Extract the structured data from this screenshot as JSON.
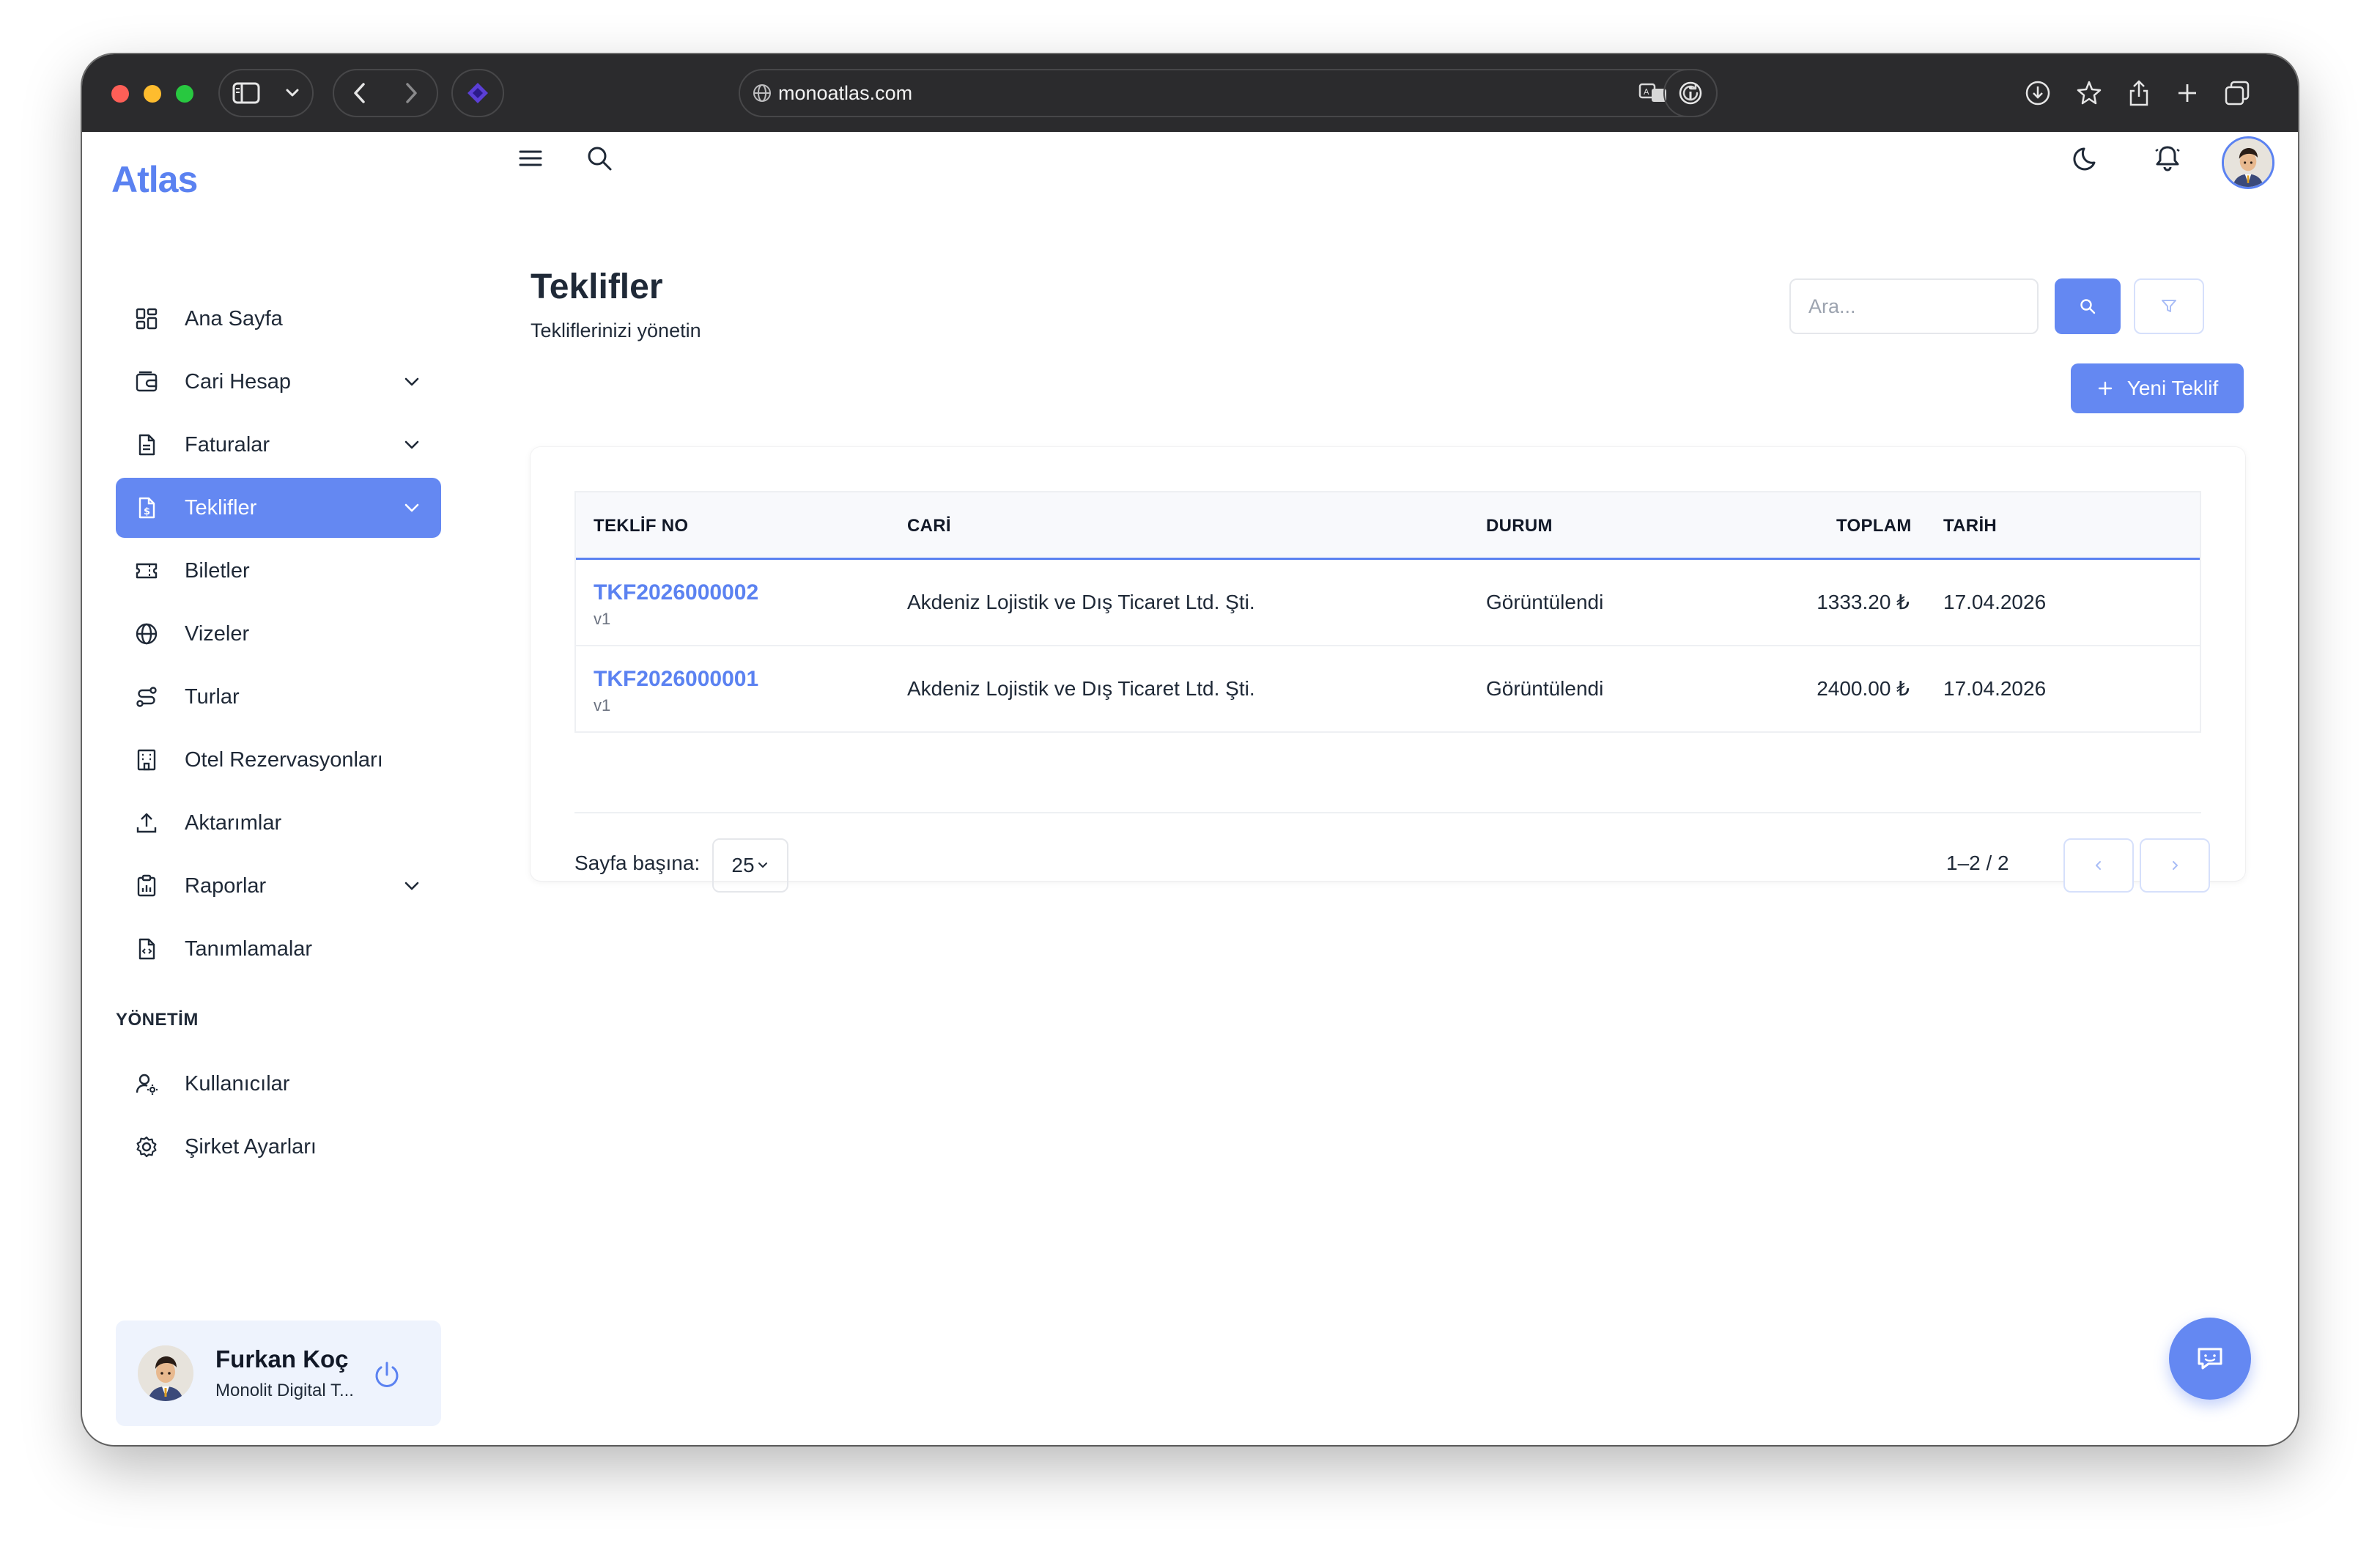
{
  "browser": {
    "url": "monoatlas.com"
  },
  "sidebar": {
    "brand": "Atlas",
    "items": [
      {
        "label": "Ana Sayfa"
      },
      {
        "label": "Cari Hesap"
      },
      {
        "label": "Faturalar"
      },
      {
        "label": "Teklifler"
      },
      {
        "label": "Biletler"
      },
      {
        "label": "Vizeler"
      },
      {
        "label": "Turlar"
      },
      {
        "label": "Otel Rezervasyonları"
      },
      {
        "label": "Aktarımlar"
      },
      {
        "label": "Raporlar"
      },
      {
        "label": "Tanımlamalar"
      }
    ],
    "section_title": "YÖNETİM",
    "admin_items": [
      {
        "label": "Kullanıcılar"
      },
      {
        "label": "Şirket Ayarları"
      }
    ],
    "user": {
      "name": "Furkan Koç",
      "company": "Monolit Digital T..."
    }
  },
  "page": {
    "title": "Teklifler",
    "subtitle": "Tekliflerinizi yönetin",
    "search_placeholder": "Ara...",
    "new_button": "Yeni Teklif"
  },
  "table": {
    "columns": [
      "TEKLİF NO",
      "CARİ",
      "DURUM",
      "TOPLAM",
      "TARİH"
    ],
    "rows": [
      {
        "no": "TKF2026000002",
        "version": "v1",
        "cari": "Akdeniz Lojistik ve Dış Ticaret Ltd. Şti.",
        "durum": "Görüntülendi",
        "toplam": "1333.20 ₺",
        "tarih": "17.04.2026"
      },
      {
        "no": "TKF2026000001",
        "version": "v1",
        "cari": "Akdeniz Lojistik ve Dış Ticaret Ltd. Şti.",
        "durum": "Görüntülendi",
        "toplam": "2400.00 ₺",
        "tarih": "17.04.2026"
      }
    ]
  },
  "pagination": {
    "per_page_label": "Sayfa başına:",
    "per_page_value": "25",
    "range": "1–2 / 2"
  },
  "colors": {
    "accent": "#6488f2",
    "brand": "#5b82f1",
    "titlebar": "#2b2b2d"
  }
}
